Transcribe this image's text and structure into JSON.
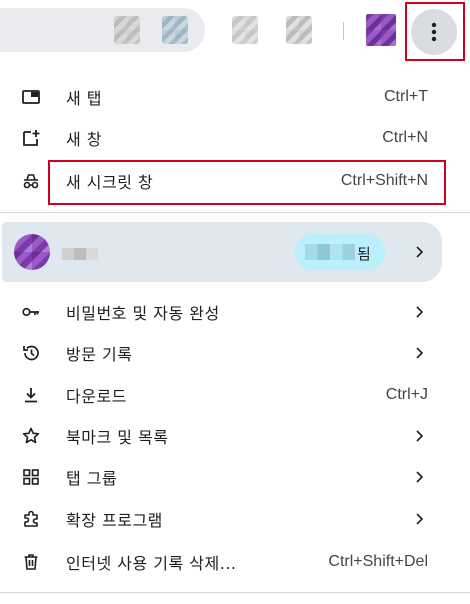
{
  "toolbar": {
    "menu_icon": "more-vert-icon",
    "extension_icons": [
      "extension-icon",
      "extension-icon",
      "extension-icon",
      "extension-icon"
    ],
    "avatar_icon": "profile-avatar-icon"
  },
  "menu": {
    "new_tab": {
      "label": "새 탭",
      "shortcut": "Ctrl+T",
      "icon": "new-tab-icon"
    },
    "new_window": {
      "label": "새 창",
      "shortcut": "Ctrl+N",
      "icon": "new-window-icon"
    },
    "new_incognito": {
      "label": "새 시크릿 창",
      "shortcut": "Ctrl+Shift+N",
      "icon": "incognito-icon"
    },
    "profile": {
      "sync_label": "됨",
      "icon": "profile-avatar-icon"
    },
    "passwords": {
      "label": "비밀번호 및 자동 완성",
      "icon": "key-icon"
    },
    "history": {
      "label": "방문 기록",
      "icon": "history-icon"
    },
    "downloads": {
      "label": "다운로드",
      "shortcut": "Ctrl+J",
      "icon": "download-icon"
    },
    "bookmarks": {
      "label": "북마크 및 목록",
      "icon": "star-icon"
    },
    "tab_groups": {
      "label": "탭 그룹",
      "icon": "tab-groups-icon"
    },
    "extensions": {
      "label": "확장 프로그램",
      "icon": "extension-icon"
    },
    "clear_data": {
      "label": "인터넷 사용 기록 삭제...",
      "shortcut": "Ctrl+Shift+Del",
      "icon": "trash-icon"
    }
  },
  "colors": {
    "highlight_box": "#d0021b",
    "profile_row_bg": "#dfe8ee",
    "sync_chip_bg": "#b9f0fb",
    "menu_button_bg": "#d9dce0"
  }
}
